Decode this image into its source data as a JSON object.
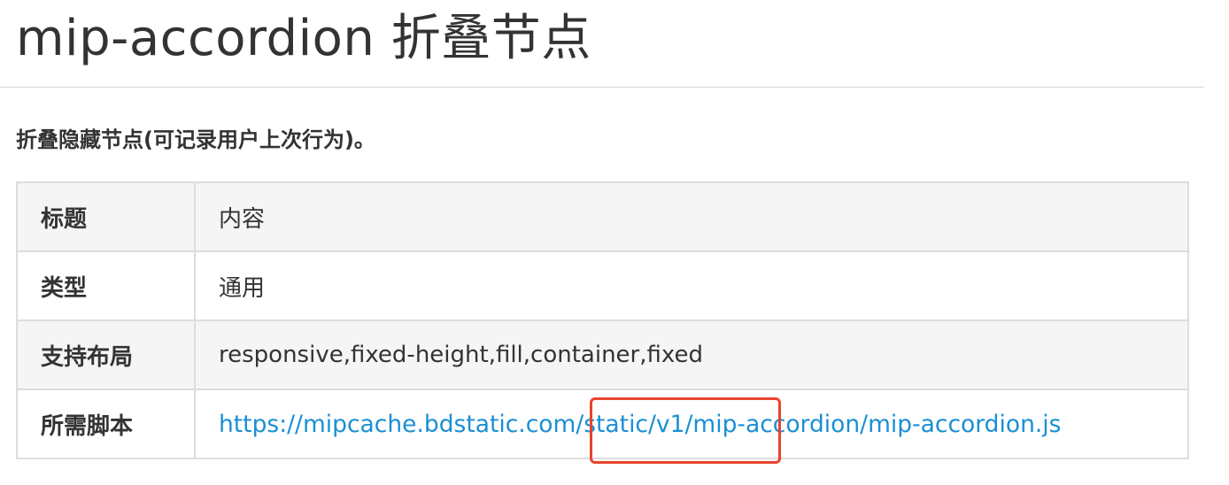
{
  "header": {
    "title": "mip-accordion 折叠节点"
  },
  "description": "折叠隐藏节点(可记录用户上次行为)。",
  "table": {
    "rows": [
      {
        "key": "标题",
        "value": "内容"
      },
      {
        "key": "类型",
        "value": "通用"
      },
      {
        "key": "支持布局",
        "value": "responsive,fixed-height,fill,container,fixed"
      },
      {
        "key": "所需脚本",
        "value": "https://mipcache.bdstatic.com/static/v1/mip-accordion/mip-accordion.js"
      }
    ]
  },
  "annotation": {
    "highlight_color": "#e8432e",
    "highlighted_text": "/static/v1/mip"
  },
  "colors": {
    "text": "#333333",
    "link": "#1a8fd4",
    "border": "#dddddd",
    "row_shade": "#f5f5f5"
  }
}
